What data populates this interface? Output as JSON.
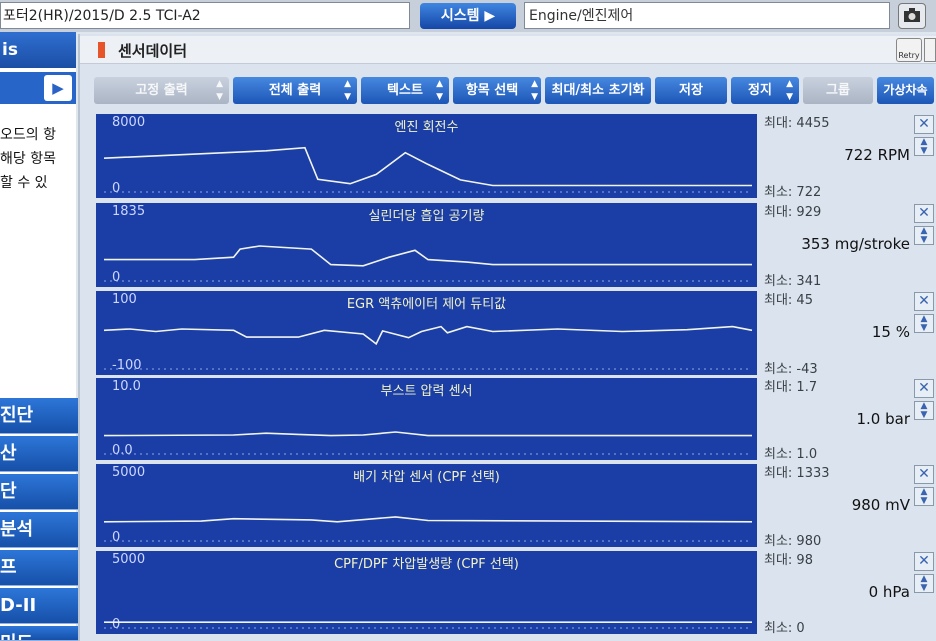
{
  "header": {
    "vehicle": "포터2(HR)/2015/D 2.5 TCI-A2",
    "system_button": "시스템",
    "system_value": "Engine/엔진제어"
  },
  "sidebar": {
    "title": "is",
    "help_lines": [
      "오드의 항",
      "해당 항목",
      "할 수 있"
    ],
    "menu": [
      "진단",
      "산",
      "단",
      "분석",
      "프",
      "D-II",
      "미드"
    ]
  },
  "panel": {
    "title": "센서데이터",
    "retry": "Retry"
  },
  "toolbar": [
    {
      "label": "고정 출력",
      "enabled": false
    },
    {
      "label": "전체 출력",
      "enabled": true
    },
    {
      "label": "텍스트",
      "enabled": true
    },
    {
      "label": "항목 선택",
      "enabled": true
    },
    {
      "label": "최대/최소 초기화",
      "enabled": true
    },
    {
      "label": "저장",
      "enabled": true
    },
    {
      "label": "정지",
      "enabled": true
    },
    {
      "label": "그룹",
      "enabled": false
    },
    {
      "label": "가상차속",
      "enabled": true
    }
  ],
  "sensors": [
    {
      "name": "엔진 회전수",
      "axis_max": "8000",
      "axis_min": "0",
      "max": "최대: 4455",
      "min": "최소: 722",
      "value": "722 RPM",
      "trace": [
        [
          0,
          0.52
        ],
        [
          0.25,
          0.4
        ],
        [
          0.31,
          0.35
        ],
        [
          0.33,
          0.86
        ],
        [
          0.38,
          0.93
        ],
        [
          0.42,
          0.78
        ],
        [
          0.465,
          0.43
        ],
        [
          0.5,
          0.62
        ],
        [
          0.55,
          0.87
        ],
        [
          0.6,
          0.96
        ],
        [
          1,
          0.96
        ]
      ]
    },
    {
      "name": "실린더당 흡입 공기량",
      "axis_max": "1835",
      "axis_min": "0",
      "max": "최대: 929",
      "min": "최소: 341",
      "value": "353 mg/stroke",
      "trace": [
        [
          0,
          0.72
        ],
        [
          0.14,
          0.72
        ],
        [
          0.2,
          0.68
        ],
        [
          0.21,
          0.55
        ],
        [
          0.24,
          0.5
        ],
        [
          0.32,
          0.55
        ],
        [
          0.35,
          0.8
        ],
        [
          0.4,
          0.82
        ],
        [
          0.44,
          0.68
        ],
        [
          0.48,
          0.57
        ],
        [
          0.5,
          0.72
        ],
        [
          0.56,
          0.76
        ],
        [
          0.6,
          0.8
        ],
        [
          1,
          0.8
        ]
      ]
    },
    {
      "name": "EGR 액츄에이터 제어 듀티값",
      "axis_max": "100",
      "axis_min": "-100",
      "max": "최대: 45",
      "min": "최소: -43",
      "value": "15 %",
      "trace": [
        [
          0,
          0.44
        ],
        [
          0.04,
          0.42
        ],
        [
          0.08,
          0.46
        ],
        [
          0.12,
          0.42
        ],
        [
          0.2,
          0.44
        ],
        [
          0.22,
          0.55
        ],
        [
          0.3,
          0.55
        ],
        [
          0.34,
          0.44
        ],
        [
          0.4,
          0.5
        ],
        [
          0.42,
          0.66
        ],
        [
          0.43,
          0.45
        ],
        [
          0.47,
          0.56
        ],
        [
          0.49,
          0.46
        ],
        [
          0.52,
          0.38
        ],
        [
          0.53,
          0.48
        ],
        [
          0.56,
          0.38
        ],
        [
          0.6,
          0.46
        ],
        [
          0.7,
          0.42
        ],
        [
          0.8,
          0.46
        ],
        [
          0.9,
          0.43
        ],
        [
          0.97,
          0.38
        ],
        [
          1,
          0.44
        ]
      ]
    },
    {
      "name": "부스트 압력 센서",
      "axis_max": "10.0",
      "axis_min": "0.0",
      "max": "최대: 1.7",
      "min": "최소: 1.0",
      "value": "1.0 bar",
      "trace": [
        [
          0,
          0.76
        ],
        [
          0.2,
          0.75
        ],
        [
          0.25,
          0.72
        ],
        [
          0.3,
          0.74
        ],
        [
          0.35,
          0.76
        ],
        [
          0.4,
          0.75
        ],
        [
          0.45,
          0.7
        ],
        [
          0.5,
          0.76
        ],
        [
          1,
          0.76
        ]
      ]
    },
    {
      "name": "배기 차압 센서 (CPF 선택)",
      "axis_max": "5000",
      "axis_min": "0",
      "max": "최대: 1333",
      "min": "최소: 980",
      "value": "980 mV",
      "trace": [
        [
          0,
          0.75
        ],
        [
          0.15,
          0.74
        ],
        [
          0.2,
          0.7
        ],
        [
          0.32,
          0.72
        ],
        [
          0.36,
          0.75
        ],
        [
          0.45,
          0.67
        ],
        [
          0.5,
          0.73
        ],
        [
          1,
          0.75
        ]
      ]
    },
    {
      "name": "CPF/DPF 차압발생량 (CPF 선택)",
      "axis_max": "5000",
      "axis_min": "0",
      "max": "최대: 98",
      "min": "최소: 0",
      "value": "0 hPa",
      "trace": [
        [
          0,
          0.97
        ],
        [
          1,
          0.97
        ]
      ]
    }
  ]
}
